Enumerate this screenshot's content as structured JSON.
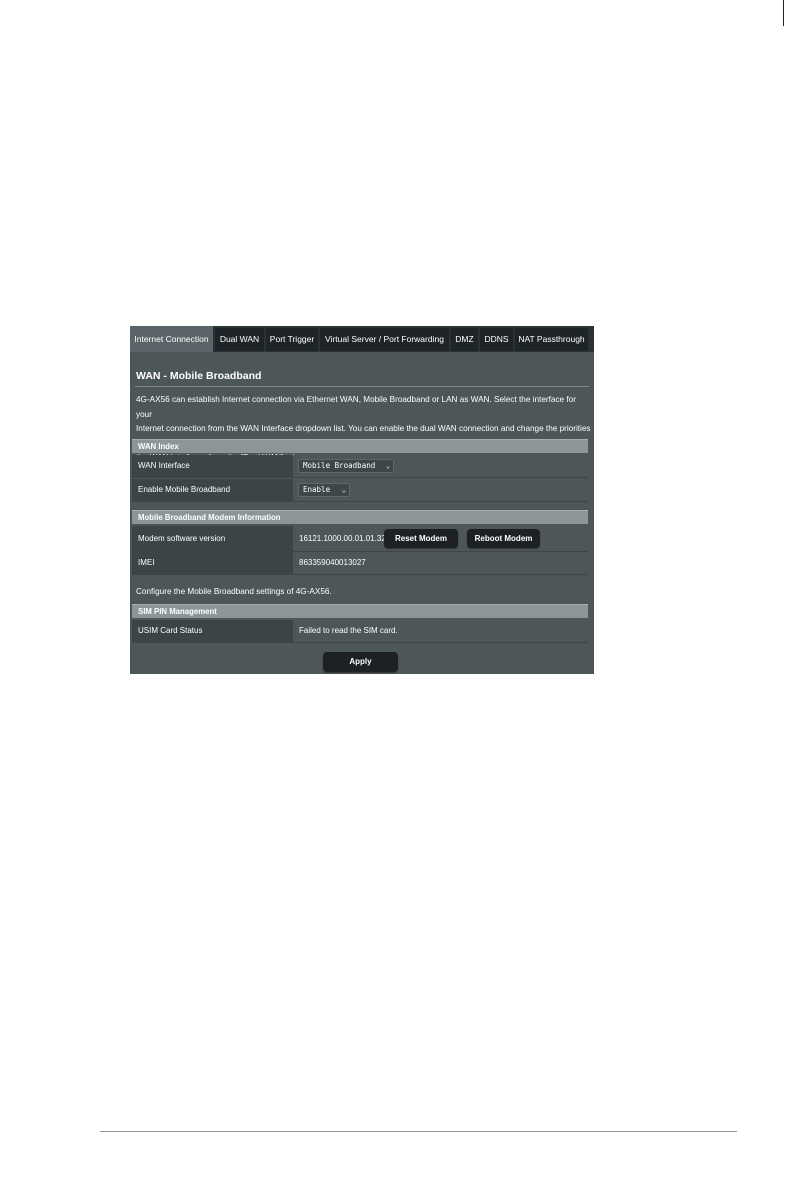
{
  "tabs": [
    "Internet Connection",
    "Dual WAN",
    "Port Trigger",
    "Virtual Server / Port Forwarding",
    "DMZ",
    "DDNS",
    "NAT Passthrough"
  ],
  "page": {
    "title": "WAN - Mobile Broadband",
    "description_lines": [
      "4G-AX56 can establish Internet connection via Ethernet WAN, Mobile Broadband or LAN as WAN. Select the interface for your",
      "Internet connection from the WAN Interface dropdown list. You can enable the dual WAN connection and change the priorities of",
      "the WAN interfaces from the [Dual WAN] tab."
    ]
  },
  "wan_index": {
    "header": "WAN Index",
    "wan_interface_label": "WAN Interface",
    "wan_interface_value": "Mobile Broadband",
    "enable_label": "Enable Mobile Broadband",
    "enable_value": "Enable"
  },
  "modem_info": {
    "header": "Mobile Broadband Modem Information",
    "version_label": "Modem software version",
    "version_value": "16121.1000.00.01.01.32",
    "reset_button": "Reset Modem",
    "reboot_button": "Reboot Modem",
    "imei_label": "IMEI",
    "imei_value": "863359040013027"
  },
  "configure_note": "Configure the Mobile Broadband settings of 4G-AX56.",
  "sim_pin": {
    "header": "SIM PIN Management",
    "status_label": "USIM Card Status",
    "status_value": "Failed to read the SIM card."
  },
  "apply_button": "Apply",
  "colors": {
    "panel": "#4d5659",
    "tab_bar": "#2b3235",
    "tab_active": "#5b6569",
    "section_header": "#8c9699",
    "warning_text": "#f5d33a"
  }
}
